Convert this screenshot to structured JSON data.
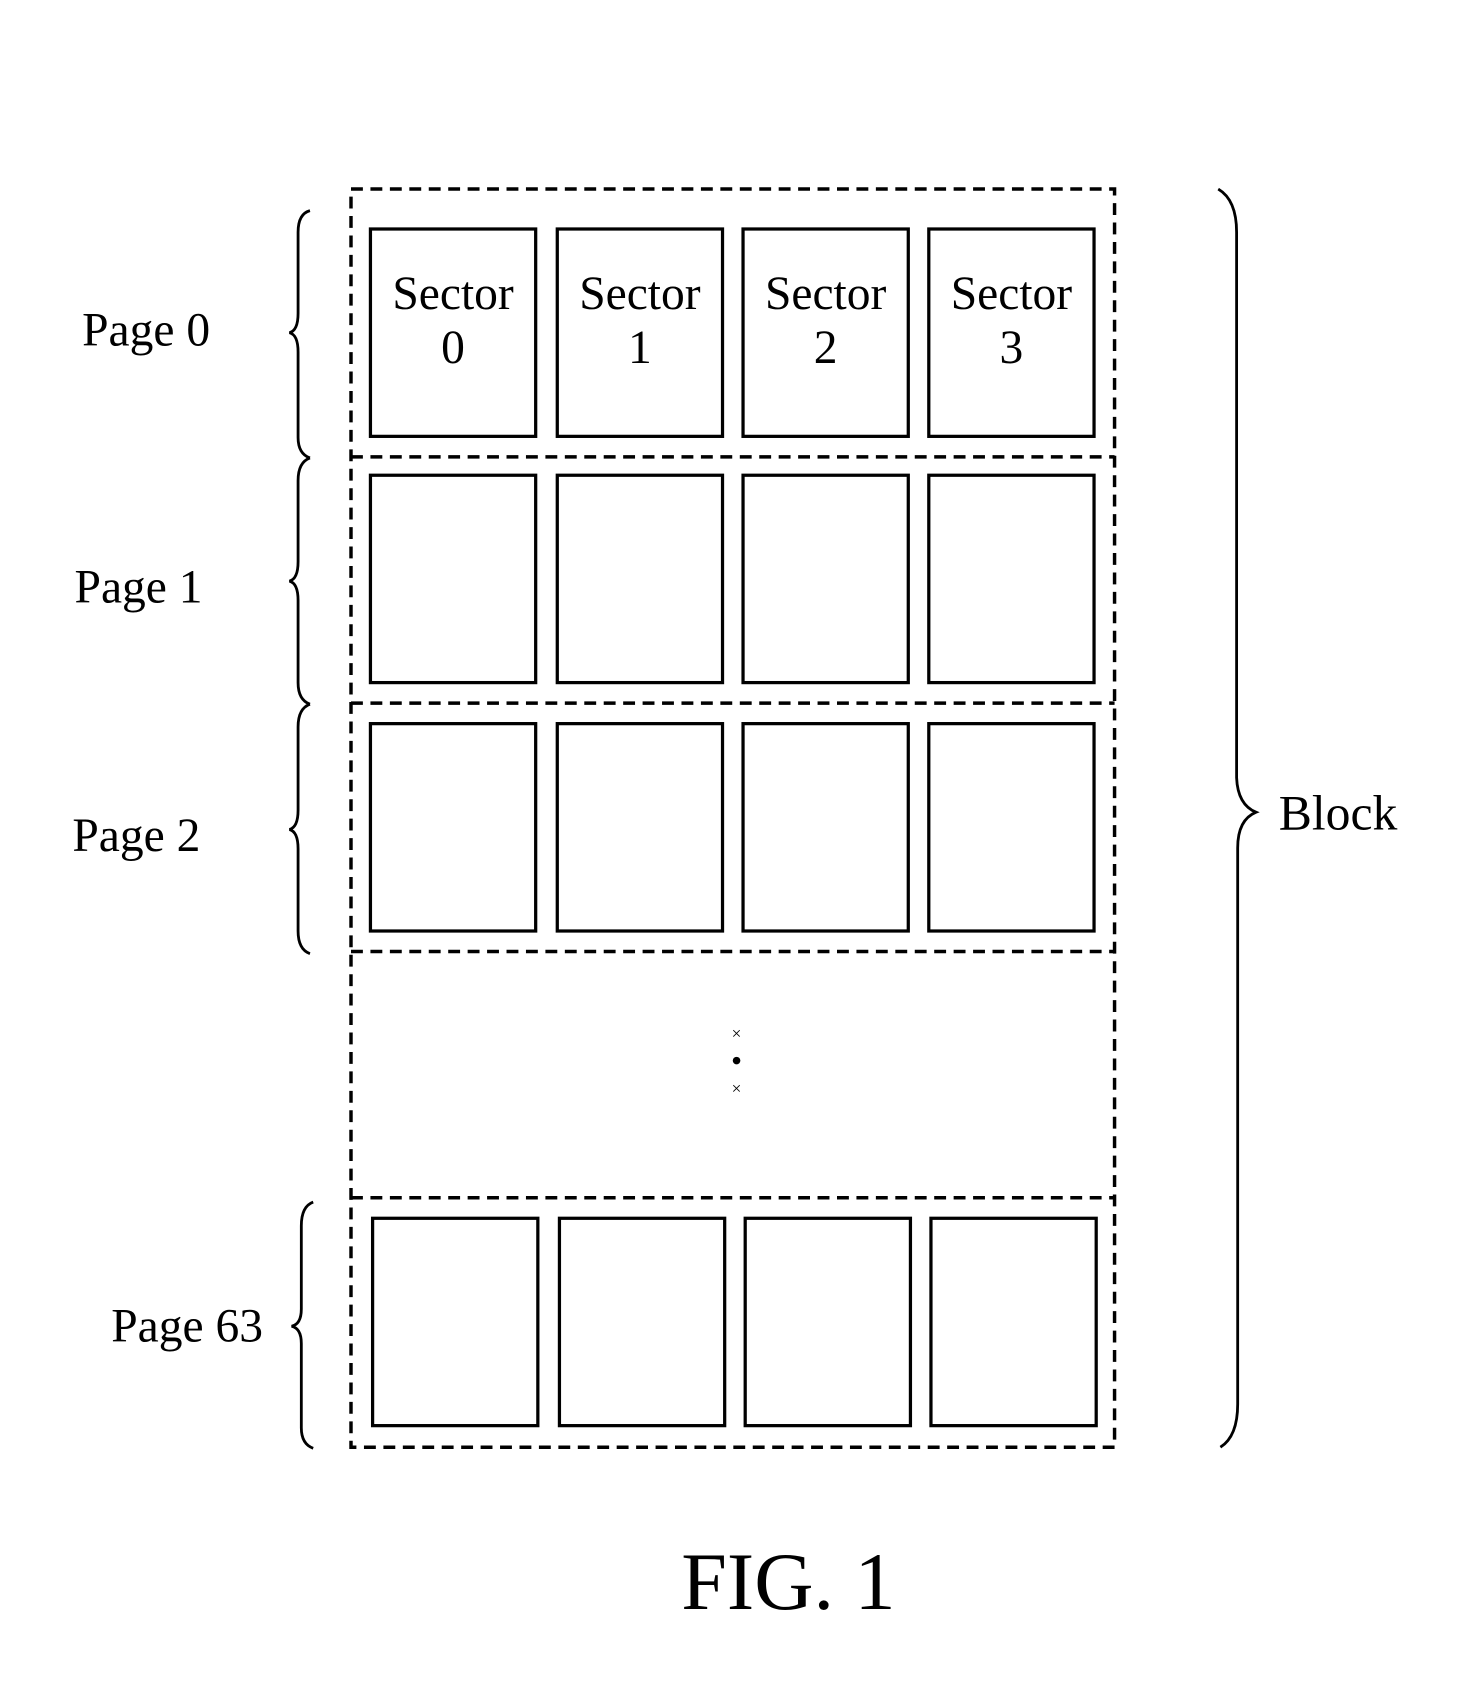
{
  "figure": {
    "caption": "FIG. 1",
    "block_label": "Block",
    "pages": [
      {
        "label": "Page 0",
        "sectors": [
          "Sector\n0",
          "Sector\n1",
          "Sector\n2",
          "Sector\n3"
        ]
      },
      {
        "label": "Page 1",
        "sectors": [
          "",
          "",
          "",
          ""
        ]
      },
      {
        "label": "Page 2",
        "sectors": [
          "",
          "",
          "",
          ""
        ]
      },
      {
        "label": "Page 63",
        "sectors": [
          "",
          "",
          "",
          ""
        ]
      }
    ],
    "sector_titles": [
      "Sector",
      "Sector",
      "Sector",
      "Sector"
    ],
    "sector_numbers": [
      "0",
      "1",
      "2",
      "3"
    ],
    "ellipsis": "⋮",
    "colors": {
      "ink": "#000000",
      "paper": "#ffffff"
    }
  }
}
